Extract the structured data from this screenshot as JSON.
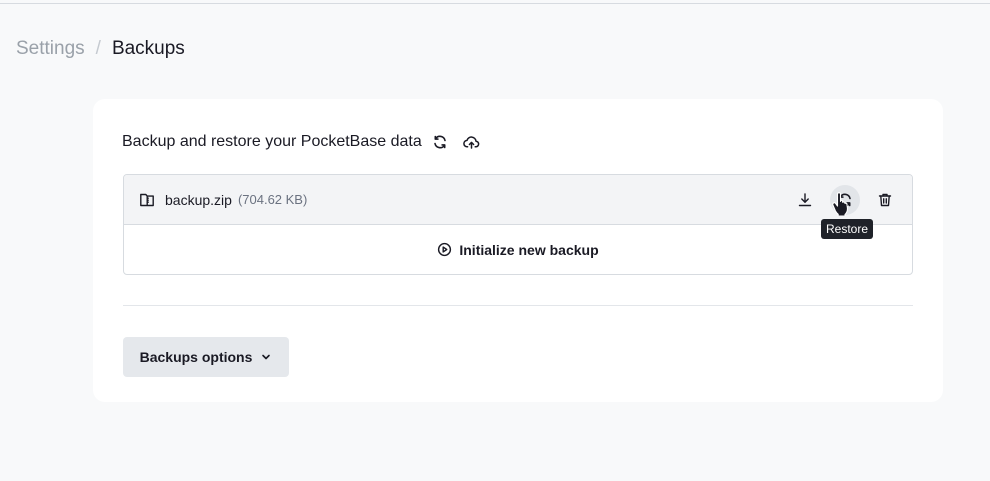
{
  "breadcrumb": {
    "parent": "Settings",
    "separator": "/",
    "current": "Backups"
  },
  "panel": {
    "heading": "Backup and restore your PocketBase data",
    "refresh_icon": "refresh-icon",
    "upload_icon": "cloud-upload-icon"
  },
  "backups": [
    {
      "name": "backup.zip",
      "size": "(704.62 KB)",
      "actions": [
        {
          "name": "download",
          "icon": "download-icon"
        },
        {
          "name": "restore",
          "icon": "restore-icon",
          "hovered": true
        },
        {
          "name": "delete",
          "icon": "trash-icon"
        }
      ]
    }
  ],
  "tooltip": {
    "text": "Restore"
  },
  "init_backup": {
    "label": "Initialize new backup",
    "icon": "play-circle-icon"
  },
  "options": {
    "label": "Backups options",
    "icon": "chevron-down-icon"
  },
  "colors": {
    "background": "#f8f9fa",
    "panel": "#ffffff",
    "item_bg": "#f3f4f6",
    "button_bg": "#e5e8ec",
    "tooltip_bg": "#1f2229",
    "text": "#1a1a24",
    "muted": "#9aa1a9"
  }
}
